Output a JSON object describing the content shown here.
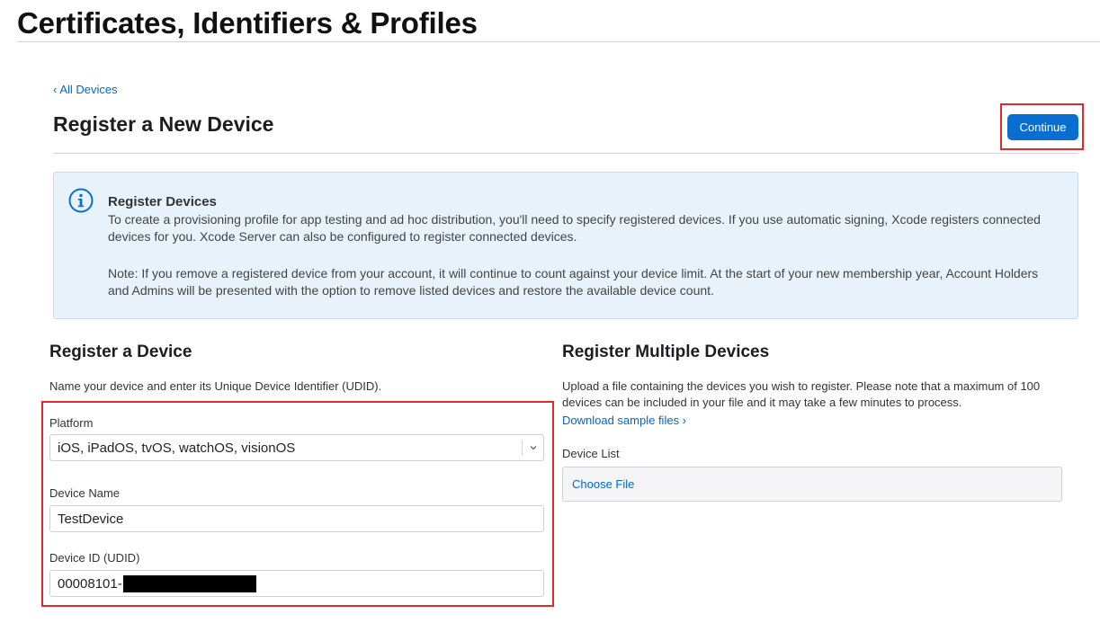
{
  "header": {
    "title": "Certificates, Identifiers & Profiles"
  },
  "nav": {
    "back_label": "All Devices"
  },
  "page": {
    "title": "Register a New Device",
    "continue_label": "Continue"
  },
  "info": {
    "title": "Register Devices",
    "paragraph1": "To create a provisioning profile for app testing and ad hoc distribution, you'll need to specify registered devices. If you use automatic signing, Xcode registers connected devices for you. Xcode Server can also be configured to register connected devices.",
    "paragraph2": "Note: If you remove a registered device from your account, it will continue to count against your device limit. At the start of your new membership year, Account Holders and Admins will be presented with the option to remove listed devices and restore the available device count."
  },
  "register_device": {
    "title": "Register a Device",
    "description": "Name your device and enter its Unique Device Identifier (UDID).",
    "platform_label": "Platform",
    "platform_value": "iOS, iPadOS, tvOS, watchOS, visionOS",
    "device_name_label": "Device Name",
    "device_name_value": "TestDevice",
    "device_id_label": "Device ID (UDID)",
    "device_id_value": "00008101-"
  },
  "register_multiple": {
    "title": "Register Multiple Devices",
    "description": "Upload a file containing the devices you wish to register. Please note that a maximum of 100 devices can be included in your file and it may take a few minutes to process.",
    "download_label": "Download sample files ›",
    "device_list_label": "Device List",
    "choose_file_label": "Choose File"
  },
  "colors": {
    "accent": "#0a6ed1",
    "link": "#0066cc",
    "highlight": "#e0282e",
    "info_bg": "#e8f2fa"
  }
}
